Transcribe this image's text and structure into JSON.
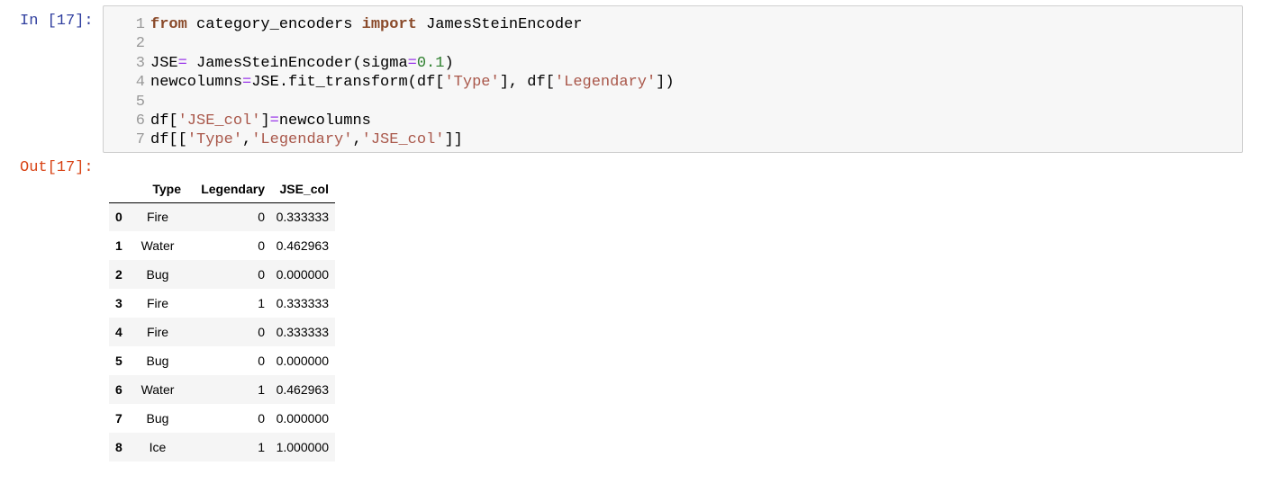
{
  "input_prompt": "In [17]:",
  "output_prompt": "Out[17]:",
  "code_lines": [
    {
      "num": "1",
      "segments": [
        {
          "t": "from",
          "c": "kw-dark"
        },
        {
          "t": " category_encoders ",
          "c": ""
        },
        {
          "t": "import",
          "c": "kw-dark"
        },
        {
          "t": " JamesSteinEncoder",
          "c": ""
        }
      ]
    },
    {
      "num": "2",
      "segments": []
    },
    {
      "num": "3",
      "segments": [
        {
          "t": "JSE",
          "c": ""
        },
        {
          "t": "=",
          "c": "opc"
        },
        {
          "t": " JamesSteinEncoder(sigma",
          "c": ""
        },
        {
          "t": "=",
          "c": "opc"
        },
        {
          "t": "0.1",
          "c": "numc"
        },
        {
          "t": ")",
          "c": ""
        }
      ]
    },
    {
      "num": "4",
      "segments": [
        {
          "t": "newcolumns",
          "c": ""
        },
        {
          "t": "=",
          "c": "opc"
        },
        {
          "t": "JSE.fit_transform(df[",
          "c": ""
        },
        {
          "t": "'Type'",
          "c": "strc"
        },
        {
          "t": "], df[",
          "c": ""
        },
        {
          "t": "'Legendary'",
          "c": "strc"
        },
        {
          "t": "])",
          "c": ""
        }
      ]
    },
    {
      "num": "5",
      "segments": []
    },
    {
      "num": "6",
      "segments": [
        {
          "t": "df[",
          "c": ""
        },
        {
          "t": "'JSE_col'",
          "c": "strc"
        },
        {
          "t": "]",
          "c": ""
        },
        {
          "t": "=",
          "c": "opc"
        },
        {
          "t": "newcolumns",
          "c": ""
        }
      ]
    },
    {
      "num": "7",
      "segments": [
        {
          "t": "df[[",
          "c": ""
        },
        {
          "t": "'Type'",
          "c": "strc"
        },
        {
          "t": ",",
          "c": ""
        },
        {
          "t": "'Legendary'",
          "c": "strc"
        },
        {
          "t": ",",
          "c": ""
        },
        {
          "t": "'JSE_col'",
          "c": "strc"
        },
        {
          "t": "]]",
          "c": ""
        }
      ]
    }
  ],
  "table": {
    "columns": [
      "",
      "Type",
      "Legendary",
      "JSE_col"
    ],
    "rows": [
      [
        "0",
        "Fire",
        "0",
        "0.333333"
      ],
      [
        "1",
        "Water",
        "0",
        "0.462963"
      ],
      [
        "2",
        "Bug",
        "0",
        "0.000000"
      ],
      [
        "3",
        "Fire",
        "1",
        "0.333333"
      ],
      [
        "4",
        "Fire",
        "0",
        "0.333333"
      ],
      [
        "5",
        "Bug",
        "0",
        "0.000000"
      ],
      [
        "6",
        "Water",
        "1",
        "0.462963"
      ],
      [
        "7",
        "Bug",
        "0",
        "0.000000"
      ],
      [
        "8",
        "Ice",
        "1",
        "1.000000"
      ]
    ]
  },
  "colors": {
    "in_prompt": "#303f9f",
    "out_prompt": "#d84315",
    "cell_background": "#f7f7f7",
    "cell_border": "#cfcfcf",
    "keyword": "#8a4a2a",
    "string": "#a9574a",
    "number": "#2d7f2d",
    "operator": "#9b39ea",
    "striped_row": "#f5f5f5"
  }
}
